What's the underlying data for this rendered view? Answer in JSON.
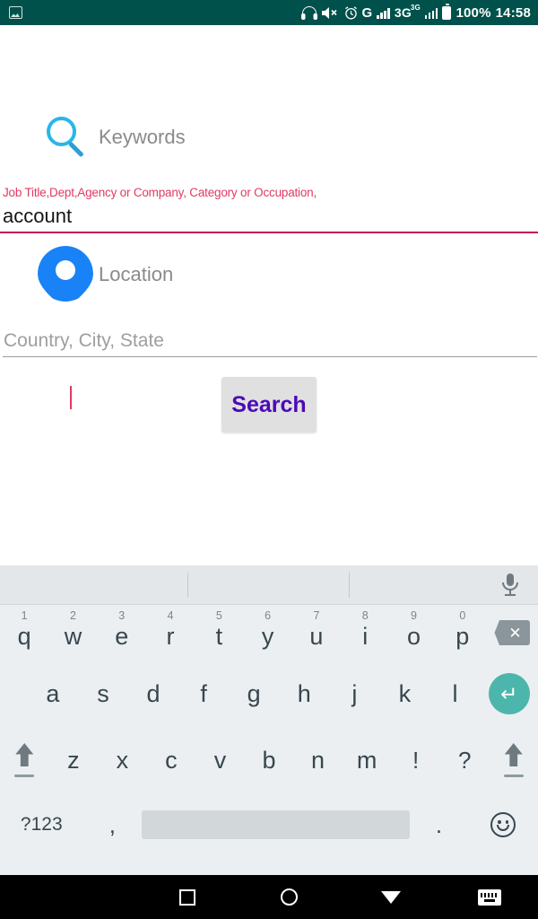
{
  "statusbar": {
    "left_icon": "image-icon",
    "headphone_icon": "headphone-icon",
    "mute_icon": "volume-mute-icon",
    "alarm_icon": "alarm-clock-icon",
    "google_label": "G",
    "network_label": "3G",
    "network_sup": "3G",
    "battery_percent": "100%",
    "time": "14:58",
    "bg_color": "#00514b",
    "fg_color": "#ffffff"
  },
  "form": {
    "keywords": {
      "icon": "search-magnifier-icon",
      "icon_color": "#29b6e8",
      "label": "Keywords",
      "hint": "Job Title,Dept,Agency or Company, Category or Occupation,",
      "hint_color": "#e03a64",
      "value": "account",
      "placeholder": "",
      "underline_color": "#c2185b"
    },
    "location": {
      "icon": "map-pin-icon",
      "icon_color": "#1a82f7",
      "label": "Location",
      "value": "",
      "placeholder": "Country, City, State",
      "underline_color": "#9b9b9b"
    },
    "search_button": {
      "label": "Search",
      "text_color": "#4b0ab8",
      "bg_color": "#e0e0e0"
    }
  },
  "keyboard": {
    "suggestion_bar": {
      "mic_icon": "microphone-icon",
      "suggestions": [
        "",
        "",
        ""
      ]
    },
    "row1": [
      {
        "key": "q",
        "num": "1"
      },
      {
        "key": "w",
        "num": "2"
      },
      {
        "key": "e",
        "num": "3"
      },
      {
        "key": "r",
        "num": "4"
      },
      {
        "key": "t",
        "num": "5"
      },
      {
        "key": "y",
        "num": "6"
      },
      {
        "key": "u",
        "num": "7"
      },
      {
        "key": "i",
        "num": "8"
      },
      {
        "key": "o",
        "num": "9"
      },
      {
        "key": "p",
        "num": "0"
      }
    ],
    "backspace_icon": "backspace-icon",
    "backspace_glyph": "✕",
    "row2": [
      "a",
      "s",
      "d",
      "f",
      "g",
      "h",
      "j",
      "k",
      "l"
    ],
    "enter_icon": "enter-key-icon",
    "enter_glyph": "↵",
    "enter_color": "#4db6ac",
    "shift_left_icon": "shift-icon",
    "row3": [
      "z",
      "x",
      "c",
      "v",
      "b",
      "n",
      "m",
      "!",
      "?"
    ],
    "shift_right_icon": "shift-icon",
    "row4": {
      "symbols_label": "?123",
      "comma_label": ",",
      "space_label": "",
      "period_label": ".",
      "emoji_icon": "emoji-smiley-icon"
    },
    "bg_color": "#eceff1"
  },
  "navbar": {
    "recents_icon": "recents-square-icon",
    "home_icon": "home-circle-icon",
    "back_icon": "back-triangle-icon",
    "keyboard_icon": "keyboard-switch-icon",
    "bg_color": "#000000"
  }
}
